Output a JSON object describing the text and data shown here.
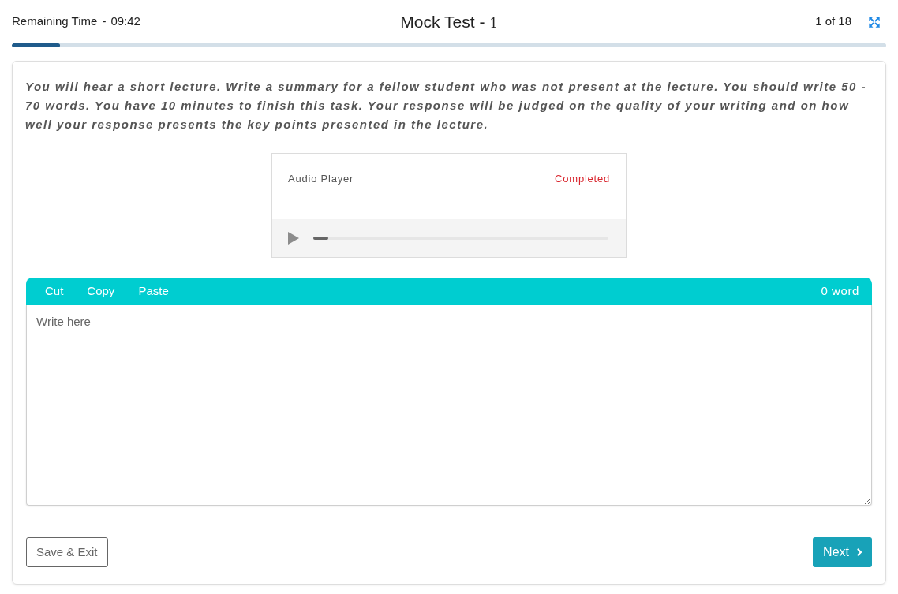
{
  "header": {
    "timer": {
      "label": "Remaining Time",
      "separator": "-",
      "value": "09:42"
    },
    "title": {
      "name": "Mock Test",
      "separator": "-",
      "number": "1"
    },
    "position": "1 of 18"
  },
  "progress": {
    "level": 0.055
  },
  "instructions": "You will hear a short lecture. Write a summary for a fellow student who was not present at the lecture. You should write 50 - 70 words. You have 10 minutes to finish this task. Your response will be judged on the quality of your writing and on how well your response presents the key points presented in the lecture.",
  "audio_player": {
    "title": "Audio Player",
    "status": "Completed",
    "level": 0.05
  },
  "editor": {
    "tools": [
      "Cut",
      "Copy",
      "Paste"
    ],
    "word_count": "0 word",
    "placeholder": "Write here"
  },
  "buttons": {
    "save": "Save & Exit",
    "next": "Next"
  }
}
